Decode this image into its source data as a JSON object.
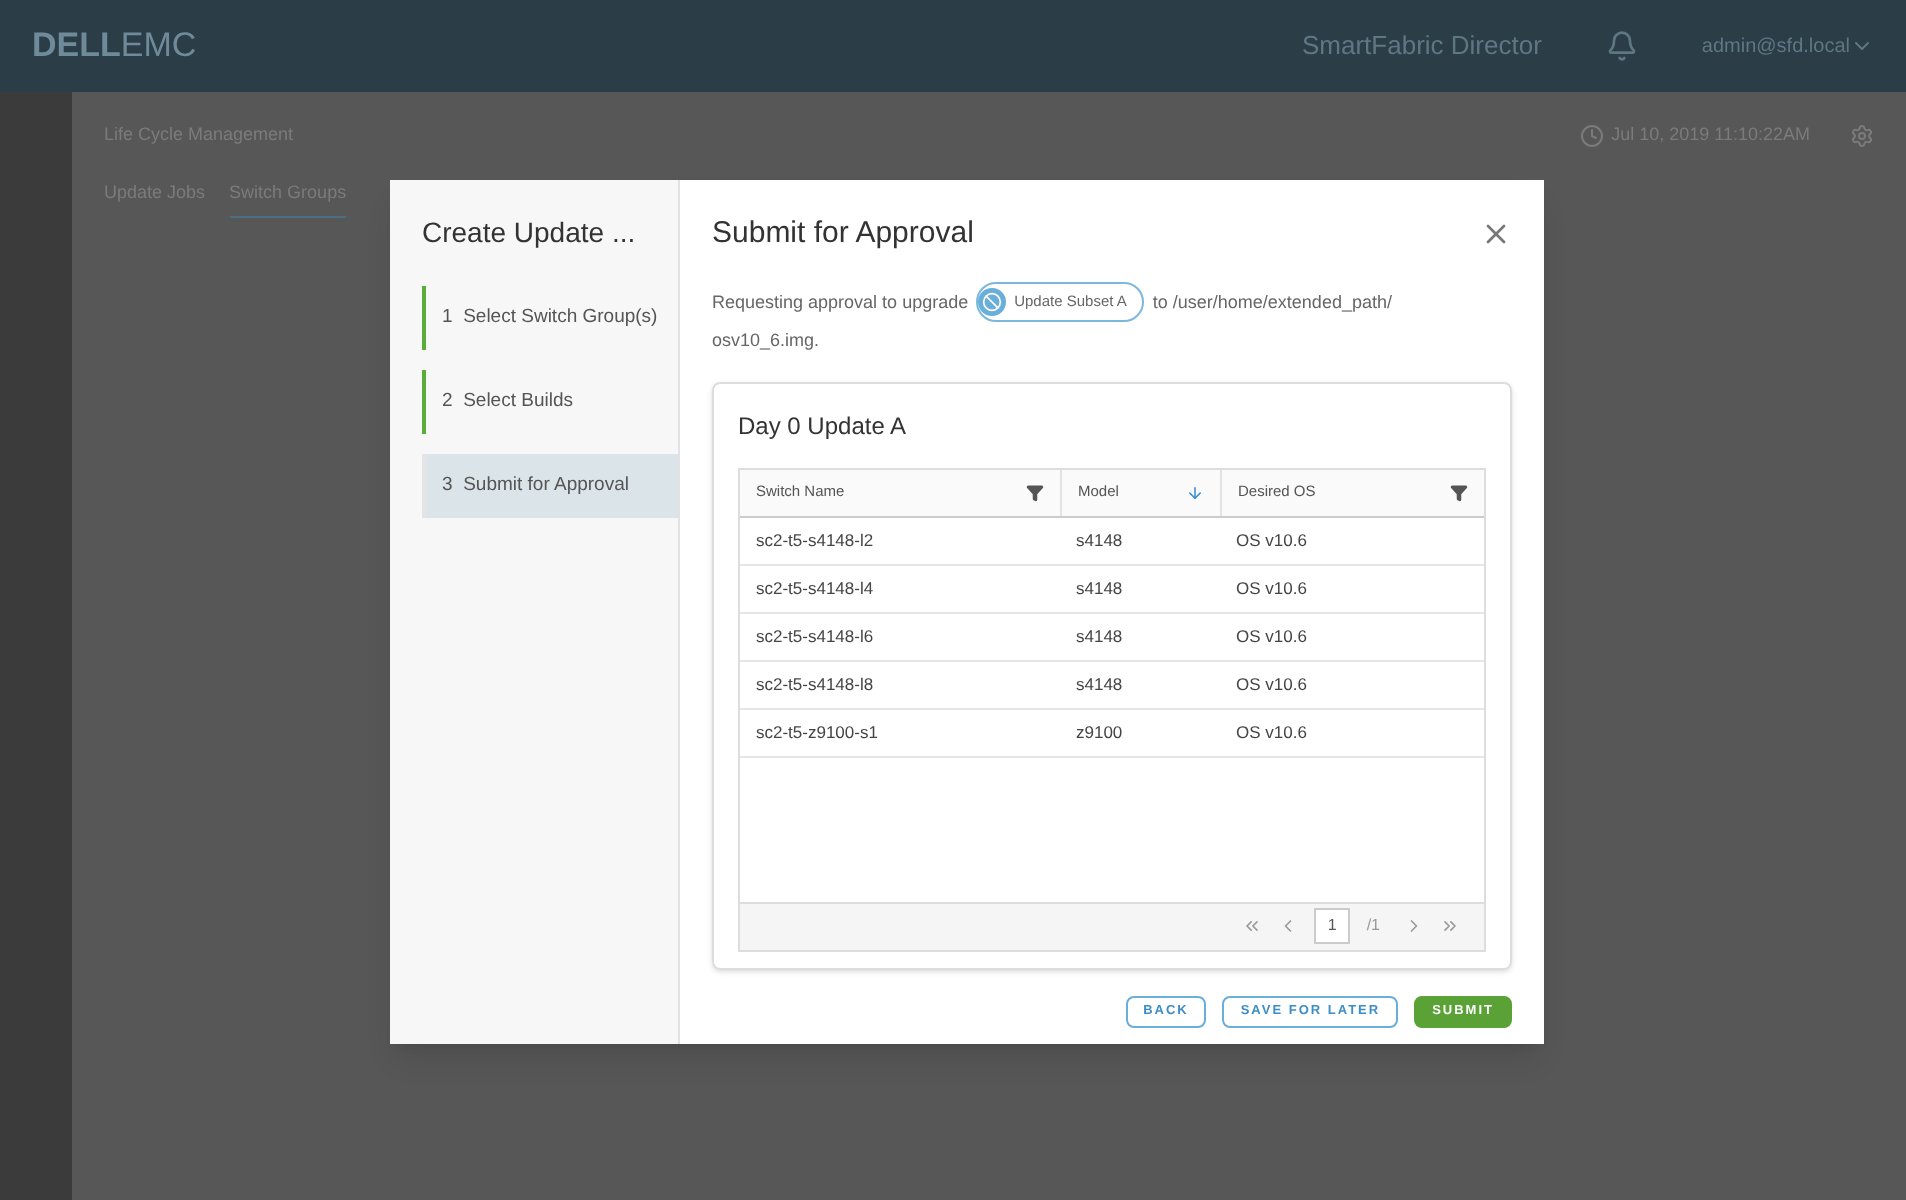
{
  "header": {
    "logo": {
      "brand": "DELL",
      "suffix": "EMC"
    },
    "product": "SmartFabric Director",
    "user": "admin@sfd.local"
  },
  "page": {
    "title": "Life Cycle Management",
    "timestamp": "Jul 10, 2019 11:10:22AM",
    "tabs": [
      {
        "label": "Update Jobs",
        "selected": false
      },
      {
        "label": "Switch Groups",
        "selected": true
      }
    ]
  },
  "dialog": {
    "wizard_title": "Create Update ...",
    "steps": [
      {
        "number": "1",
        "label": "Select Switch Group(s)",
        "completed": true,
        "selected": false
      },
      {
        "number": "2",
        "label": "Select Builds",
        "completed": true,
        "selected": false
      },
      {
        "number": "3",
        "label": "Submit for Approval",
        "completed": false,
        "selected": true
      }
    ],
    "title": "Submit for Approval",
    "message_before": "Requesting approval to upgrade",
    "chip": "Update Subset A",
    "message_after": "to /user/home/extended_path/",
    "message_end": "osv10_6.img.",
    "card_title": "Day 0 Update A",
    "columns": [
      {
        "label": "Switch Name",
        "kind": "filter"
      },
      {
        "label": "Model",
        "kind": "sort"
      },
      {
        "label": "Desired OS",
        "kind": "filter"
      }
    ],
    "rows": [
      [
        "sc2-t5-s4148-l2",
        "s4148",
        "OS v10.6"
      ],
      [
        "sc2-t5-s4148-l4",
        "s4148",
        "OS v10.6"
      ],
      [
        "sc2-t5-s4148-l6",
        "s4148",
        "OS v10.6"
      ],
      [
        "sc2-t5-s4148-l8",
        "s4148",
        "OS v10.6"
      ],
      [
        "sc2-t5-z9100-s1",
        "z9100",
        "OS v10.6"
      ]
    ],
    "pagination": {
      "page": "1",
      "total": "/1"
    },
    "buttons": [
      {
        "label": "BACK",
        "kind": "outline"
      },
      {
        "label": "SAVE FOR LATER",
        "kind": "outline"
      },
      {
        "label": "SUBMIT",
        "kind": "primary"
      }
    ]
  }
}
